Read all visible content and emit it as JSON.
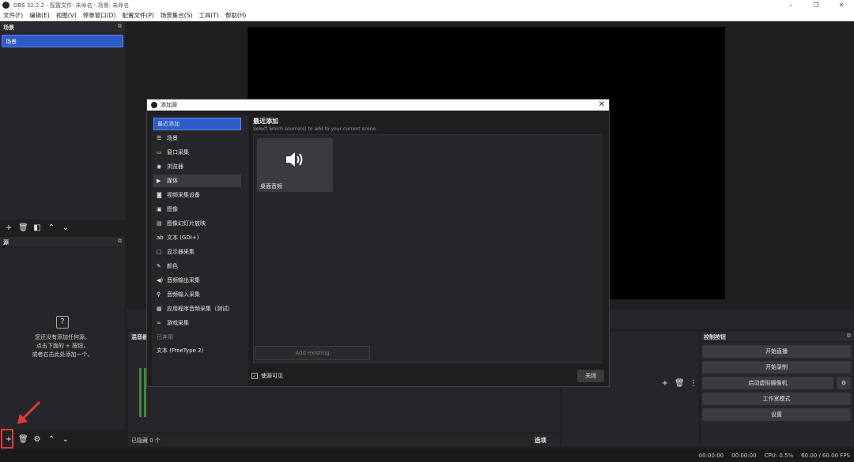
{
  "titlebar": {
    "title": "OBS 32.2.2 - 配置文件: 未命名 - 场景: 未命名",
    "minimize": "–",
    "maximize": "❐",
    "close": "✕"
  },
  "menu": [
    "文件(F)",
    "编辑(E)",
    "视图(V)",
    "停靠窗口(D)",
    "配置文件(P)",
    "场景集合(S)",
    "工具(T)",
    "帮助(H)"
  ],
  "scenes_dock": {
    "header": "场景",
    "items": [
      "场景"
    ]
  },
  "sources_dock": {
    "header": "源",
    "empty_lines": [
      "您还没有添加任何源。",
      "点击下面的 + 按钮，",
      "或者右击此处添加一个。"
    ]
  },
  "mixer": {
    "header": "混音器",
    "bottom_status": "已隐藏 0 个"
  },
  "controls_dock": {
    "header": "控制按钮",
    "buttons": [
      "开始直播",
      "开始录制",
      "启动虚拟摄像机",
      "工作室模式",
      "设置"
    ]
  },
  "bottom_toolbar": {
    "options": "选项"
  },
  "status": {
    "t1": "00:00:00",
    "t2": "00:00:00",
    "cpu": "CPU: 0.5%",
    "fps": "60.00 / 60.00 FPS"
  },
  "dialog": {
    "title": "添加源",
    "items": [
      {
        "label": "最近添加",
        "icon": ""
      },
      {
        "label": "场景",
        "icon": "☰"
      },
      {
        "label": "窗口采集",
        "icon": "▭"
      },
      {
        "label": "浏览器",
        "icon": "◉"
      },
      {
        "label": "媒体",
        "icon": "▶"
      },
      {
        "label": "视频采集设备",
        "icon": "◙"
      },
      {
        "label": "图像",
        "icon": "▣"
      },
      {
        "label": "图像幻灯片放映",
        "icon": "▤"
      },
      {
        "label": "文本 (GDI+)",
        "icon": "ab"
      },
      {
        "label": "显示器采集",
        "icon": "▢"
      },
      {
        "label": "颜色",
        "icon": "✎"
      },
      {
        "label": "音频输出采集",
        "icon": "◀)"
      },
      {
        "label": "音频输入采集",
        "icon": "♀"
      },
      {
        "label": "应用程序音频采集（测试）",
        "icon": "▦"
      },
      {
        "label": "游戏采集",
        "icon": "∞"
      }
    ],
    "deprecated_label": "已弃用",
    "deprecated_item": "文本 (FreeType 2)",
    "main_title": "最近添加",
    "main_sub": "Select which source(s) to add to your current scene.",
    "tile_label": "桌面音频",
    "add_existing": "Add existing",
    "visible_label": "使源可见",
    "close_label": "关闭"
  }
}
